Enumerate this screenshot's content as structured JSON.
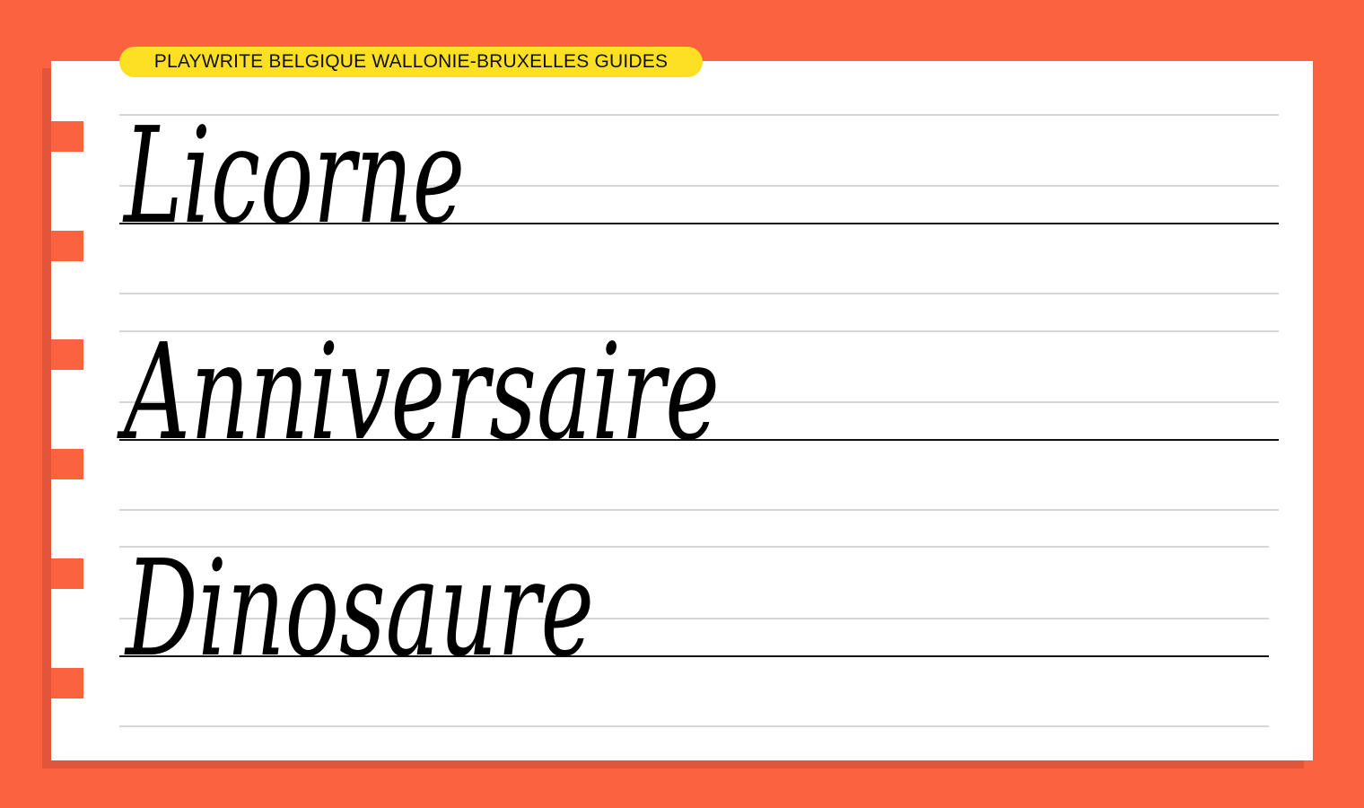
{
  "header": {
    "title": "PLAYWRITE BELGIQUE WALLONIE-BRUXELLES GUIDES"
  },
  "colors": {
    "background": "#fb6340",
    "shadow": "#e2553a",
    "paper": "#ffffff",
    "pill": "#fde024",
    "guide_line": "#c9c9c9",
    "baseline": "#111111"
  },
  "words": [
    {
      "text": "Licorne"
    },
    {
      "text": "Anniversaire"
    },
    {
      "text": "Dinosaure"
    }
  ]
}
